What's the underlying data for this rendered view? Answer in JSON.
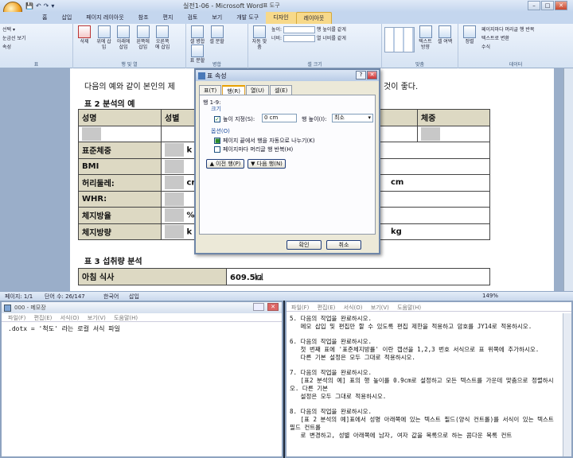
{
  "app": {
    "title": "실전1-06 - Microsoft Word",
    "context_tab_group": "표 도구",
    "qat": [
      "💾",
      "↶",
      "↷",
      "▾"
    ]
  },
  "tabs": [
    "홈",
    "삽입",
    "페이지 레이아웃",
    "참조",
    "편지",
    "검토",
    "보기",
    "개발 도구",
    "디자인",
    "레이아웃"
  ],
  "active_tab": "레이아웃",
  "ribbon": {
    "table_group": {
      "items": [
        "선택 ▾",
        "눈금선 보기",
        "속성"
      ],
      "label": "표"
    },
    "rows_cols": {
      "delete": "삭제",
      "insert_above": "위에 삽입",
      "insert_below": "아래에 삽입",
      "insert_left": "왼쪽에 삽입",
      "insert_right": "오른쪽에 삽입",
      "label": "행 및 열"
    },
    "merge": {
      "merge_cells": "셀 병합",
      "split_cells": "셀 분할",
      "split_table": "표 분할",
      "label": "병합"
    },
    "cell_size": {
      "autofit": "자동 맞춤",
      "height_label": "높이:",
      "width_label": "너비:",
      "dist_rows": "행 높이를 같게",
      "dist_cols": "열 너비를 같게",
      "label": "셀 크기"
    },
    "alignment": {
      "text_dir": "텍스트 방향",
      "margins": "셀 여백",
      "label": "맞춤"
    },
    "data": {
      "sort": "정렬",
      "repeat_header": "페이지마다 머리글 행 반복",
      "convert": "텍스트로 변환",
      "formula": "수식",
      "label": "데이터"
    }
  },
  "document": {
    "intro_text": "다음의 예와 같이 본인의 제",
    "intro_tail": "것이 좋다.",
    "table2_caption": "표 2 분석의 예",
    "table2": {
      "headers": [
        "성명",
        "성별",
        "",
        "",
        "체중"
      ],
      "rows": [
        {
          "label": "표준체중",
          "unit": "k"
        },
        {
          "label": "BMI",
          "unit": ""
        },
        {
          "label": "허리둘레:",
          "unit": "cr",
          "right": "cm"
        },
        {
          "label": "WHR:",
          "unit": ""
        },
        {
          "label": "체지방율",
          "unit": "%"
        },
        {
          "label": "체지방량",
          "unit": "k",
          "right": "kg"
        }
      ]
    },
    "table3_caption": "표 3 섭취량 분석",
    "table3": {
      "row_label": "아침 식사",
      "row_value": "609.5㎉"
    }
  },
  "status": {
    "page": "페이지: 1/1",
    "words": "단어 수: 26/147",
    "lang": "한국어",
    "mode": "삽입",
    "zoom": "149%"
  },
  "dialog": {
    "title": "표 속성",
    "tabs": [
      "표(T)",
      "행(R)",
      "열(U)",
      "셀(E)"
    ],
    "active_tab": "행(R)",
    "row_heading": "행 1-9:",
    "size_label": "크기",
    "specify_height": "높이 지정(S):",
    "height_value": "0 cm",
    "height_is_label": "행 높이(I):",
    "height_is_value": "최소",
    "options_label": "옵션(O)",
    "allow_break": "페이지 끝에서 행을 자동으로 나누기(K)",
    "repeat_header": "페이지마다 머리글 행 반복(H)",
    "prev_row": "▲ 이전 행(P)",
    "next_row": "▼ 다음 행(N)",
    "ok": "확인",
    "cancel": "취소"
  },
  "notepad": {
    "title": "000 - 메모장",
    "menus": [
      "파일(F)",
      "편집(E)",
      "서식(O)",
      "보기(V)",
      "도움말(H)"
    ],
    "content": ".dotx = '척도' 라는 로컬 서식 파일"
  },
  "right_pane": {
    "menus": [
      "파일(F)",
      "편집(E)",
      "서식(O)",
      "보기(V)",
      "도움말(H)"
    ],
    "lines": [
      "5. 다음의 작업을 완료하시오.\n   메모 삽입 및 편집만 할 수 있도록 편집 제한을 적용하고 암호를 JY14로 적용하시오.",
      "6. 다음의 작업을 완료하시오.\n   첫 번째 표에 '표준체지방률' 이란 캡션을 1,2,3 번호 서식으로 표 위쪽에 추가하시오.\n   다른 기본 설정은 모두 그대로 적용하시오.",
      "7. 다음의 작업을 완료하시오.\n   [표2 분석의 예] 표의 행 높이를 0.9cm로 설정하고 모든 텍스트를 가운데 맞춤으로 정렬하시오. 다른 기본\n   설정은 모두 그대로 적용하시오.",
      "8. 다음의 작업을 완료하시오.\n   [표 2 분석의 예]표에서 성명 아래쪽에 있는 텍스트 필드(양식 컨트롤)를 서식이 있는 텍스트 필드 컨트롤\n   로 변경하고, 성별 아래쪽에 남자, 여자 값을 목록으로 하는 콤다운 목록 컨트"
    ]
  }
}
